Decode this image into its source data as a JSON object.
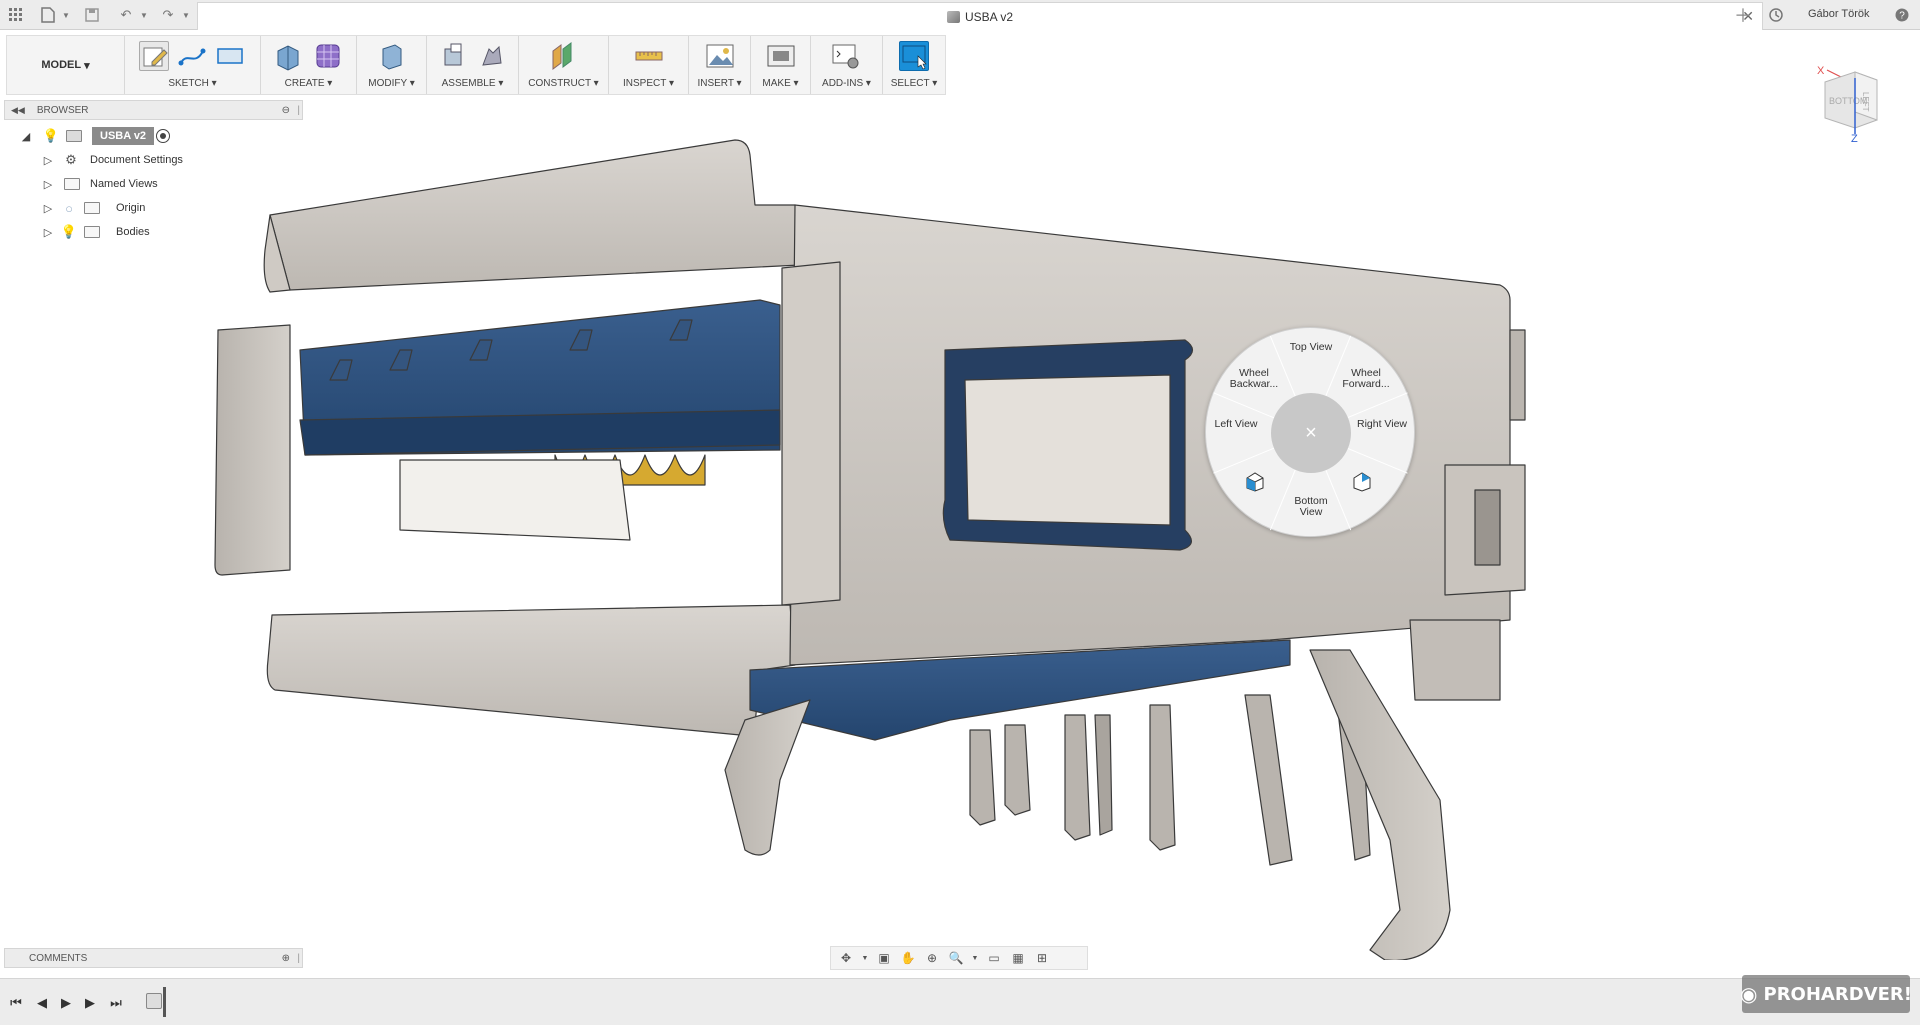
{
  "window": {
    "document_title": "USBA v2",
    "user_name": "Gábor Török",
    "help_icon": "help-icon"
  },
  "toolbar": {
    "workspace": "MODEL",
    "groups": [
      {
        "label": "SKETCH"
      },
      {
        "label": "CREATE"
      },
      {
        "label": "MODIFY"
      },
      {
        "label": "ASSEMBLE"
      },
      {
        "label": "CONSTRUCT"
      },
      {
        "label": "INSPECT"
      },
      {
        "label": "INSERT"
      },
      {
        "label": "MAKE"
      },
      {
        "label": "ADD-INS"
      },
      {
        "label": "SELECT"
      }
    ],
    "accent": "#1a8fd8"
  },
  "browser": {
    "title": "BROWSER",
    "root": "USBA v2",
    "items": [
      {
        "label": "Document Settings"
      },
      {
        "label": "Named Views"
      },
      {
        "label": "Origin"
      },
      {
        "label": "Bodies"
      }
    ]
  },
  "viewcube": {
    "front_face": "BOTTOM",
    "side_face": "LEFT",
    "axis_x": "X",
    "axis_z": "Z"
  },
  "marking_menu": {
    "top": "Top View",
    "top_right": "Wheel Forward...",
    "right": "Right View",
    "bottom": "Bottom View",
    "left": "Left View",
    "top_left": "Wheel Backwar...",
    "center": "×"
  },
  "comments": {
    "title": "COMMENTS"
  },
  "watermark": {
    "text": "PROHARDVER!"
  }
}
